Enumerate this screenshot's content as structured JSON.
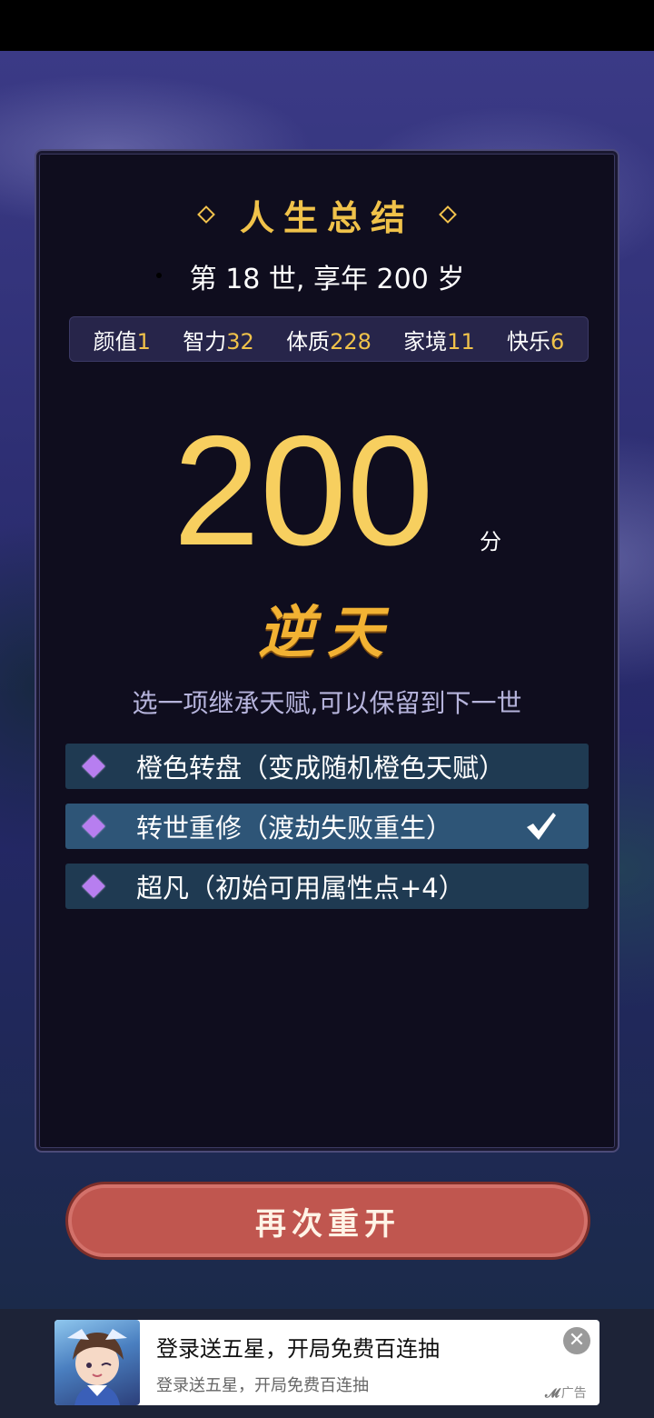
{
  "summary": {
    "title": "人生总结",
    "subtitle": "第 18 世, 享年 200 岁"
  },
  "attributes": [
    {
      "label": "颜值",
      "value": "1"
    },
    {
      "label": "智力",
      "value": "32"
    },
    {
      "label": "体质",
      "value": "228"
    },
    {
      "label": "家境",
      "value": "11"
    },
    {
      "label": "快乐",
      "value": "6"
    }
  ],
  "score": {
    "value": "200",
    "unit": "分",
    "grade": "逆天"
  },
  "inherit": {
    "prompt": "选一项继承天赋,可以保留到下一世",
    "options": [
      {
        "label": "橙色转盘（变成随机橙色天赋）",
        "selected": false
      },
      {
        "label": "转世重修（渡劫失败重生）",
        "selected": true
      },
      {
        "label": "超凡（初始可用属性点+4）",
        "selected": false
      }
    ]
  },
  "actions": {
    "restart_label": "再次重开"
  },
  "ad": {
    "title": "登录送五星，开局免费百连抽",
    "description": "登录送五星，开局免费百连抽",
    "label": "广告",
    "close_icon": "close-icon"
  },
  "colors": {
    "gold": "#f7cf5f",
    "panel": "#0f0d1e",
    "option_selected": "#2e5577",
    "button": "#c0564f"
  }
}
